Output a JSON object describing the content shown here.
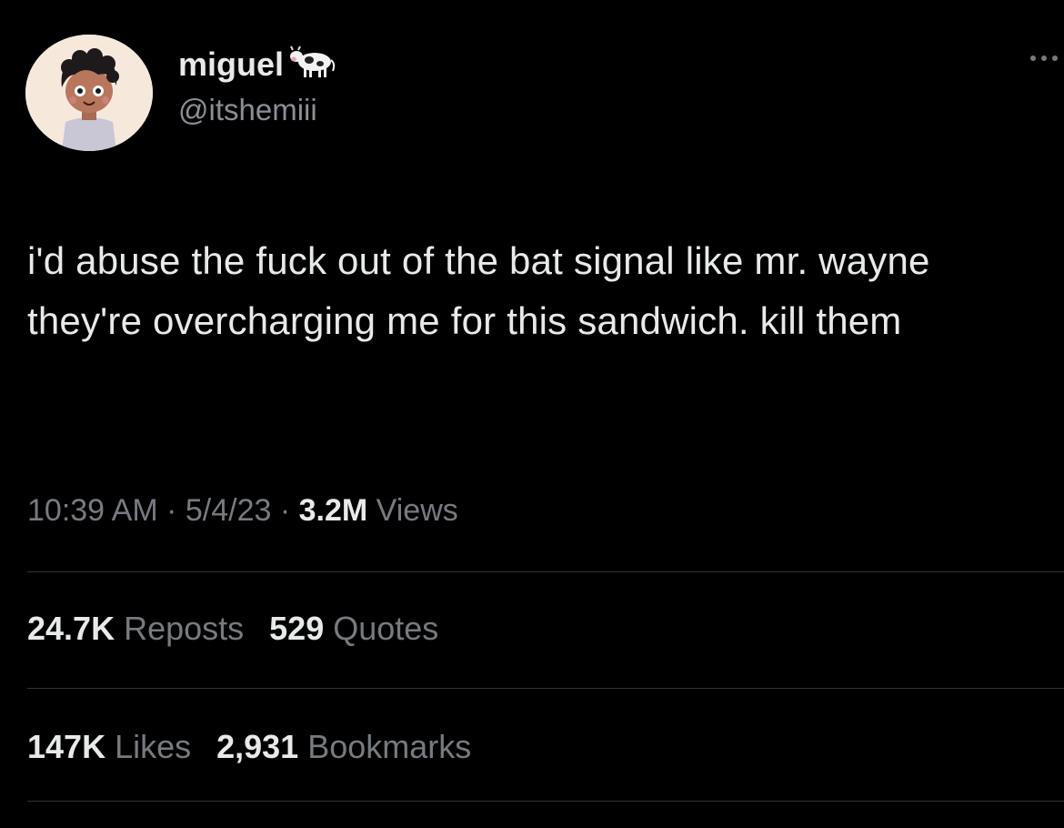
{
  "author": {
    "display_name": "miguel",
    "handle": "@itshemiii",
    "badge_icon": "cow-emoji-icon",
    "avatar": "cartoon-boy-avatar"
  },
  "tweet": {
    "text": "i'd abuse the fuck out of the bat signal like mr. wayne they're overcharging me for this sandwich. kill them"
  },
  "meta": {
    "time": "10:39 AM",
    "sep1": " · ",
    "date": "5/4/23",
    "sep2": " · ",
    "views_count": "3.2M",
    "views_label": " Views"
  },
  "stats_row1": {
    "reposts_count": "24.7K",
    "reposts_label": " Reposts",
    "quotes_count": "529",
    "quotes_label": " Quotes"
  },
  "stats_row2": {
    "likes_count": "147K",
    "likes_label": " Likes",
    "bookmarks_count": "2,931",
    "bookmarks_label": " Bookmarks"
  },
  "colors": {
    "background": "#000000",
    "primary_text": "#e7e9ea",
    "secondary_text": "#777b80",
    "divider": "#2f3336"
  }
}
